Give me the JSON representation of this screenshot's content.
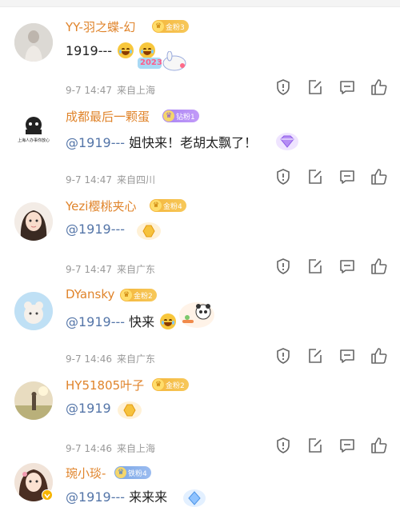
{
  "comments": [
    {
      "username": "YY-羽之蝶-幻",
      "badge": {
        "label": "金粉3",
        "type": "gold"
      },
      "text": "1919---",
      "mention": "",
      "time": "9-7 14:47",
      "location": "来自上海",
      "sticker": "2023 bunny sticker",
      "sticker_text": "2023"
    },
    {
      "username": "成都最后一颗蛋",
      "badge": {
        "label": "钻粉1",
        "type": "diamond"
      },
      "text": " 姐快来！老胡太飘了！",
      "mention": "@1919---",
      "time": "9-7 14:47",
      "location": "来自四川",
      "avatar_text": "上海人办事你放心"
    },
    {
      "username": "Yezi樱桃夹心",
      "badge": {
        "label": "金粉4",
        "type": "gold"
      },
      "text": "",
      "mention": "@1919---",
      "time": "9-7 14:47",
      "location": "来自广东"
    },
    {
      "username": "DYansky",
      "badge": {
        "label": "金粉2",
        "type": "gold"
      },
      "text": " 快来",
      "mention": "@1919---",
      "time": "9-7 14:46",
      "location": "来自广东"
    },
    {
      "username": "HY51805叶子",
      "badge": {
        "label": "金粉2",
        "type": "gold"
      },
      "text": "",
      "mention": "@1919",
      "time": "9-7 14:46",
      "location": "来自上海"
    },
    {
      "username": "琬小琰-",
      "badge": {
        "label": "铁粉4",
        "type": "iron"
      },
      "text": " 来来来",
      "mention": "@1919---",
      "time": "",
      "location": ""
    }
  ],
  "icons": {
    "report": "shield-exclamation-icon",
    "repost": "share-edit-icon",
    "comment": "comment-bubble-icon",
    "like": "thumbs-up-icon"
  },
  "colors": {
    "username": "#e0842b",
    "mention": "#5475a8",
    "meta": "#999999"
  }
}
